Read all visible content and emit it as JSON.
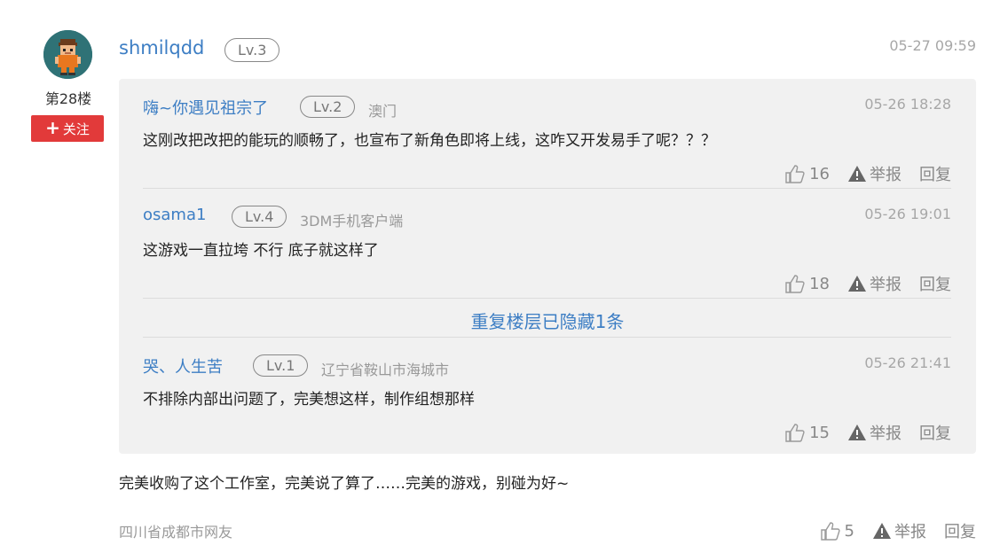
{
  "post": {
    "floor": "第28楼",
    "follow_label": "关注",
    "username": "shmilqdd",
    "level": "Lv.3",
    "time": "05-27 09:59",
    "text": "完美收购了这个工作室，完美说了算了……完美的游戏，别碰为好~",
    "location": "四川省成都市网友",
    "likes": "5",
    "report_label": "举报",
    "reply_label": "回复"
  },
  "replies": [
    {
      "username": "嗨~你遇见祖宗了",
      "level": "Lv.2",
      "location": "澳门",
      "time": "05-26 18:28",
      "text": "这刚改把改把的能玩的顺畅了，也宣布了新角色即将上线，这咋又开发易手了呢？？？",
      "likes": "16",
      "report_label": "举报",
      "reply_label": "回复"
    },
    {
      "username": "osama1",
      "level": "Lv.4",
      "location": "3DM手机客户端",
      "time": "05-26 19:01",
      "text": "这游戏一直拉垮 不行 底子就这样了",
      "likes": "18",
      "report_label": "举报",
      "reply_label": "回复"
    },
    {
      "username": "哭、人生苦",
      "level": "Lv.1",
      "location": "辽宁省鞍山市海城市",
      "time": "05-26 21:41",
      "text": "不排除内部出问题了，完美想这样，制作组想那样",
      "likes": "15",
      "report_label": "举报",
      "reply_label": "回复"
    }
  ],
  "hidden_note": "重复楼层已隐藏1条",
  "colors": {
    "link_blue": "#3d7ec4",
    "follow_red": "#e23a3a",
    "reply_bg": "#f1f1f1"
  }
}
